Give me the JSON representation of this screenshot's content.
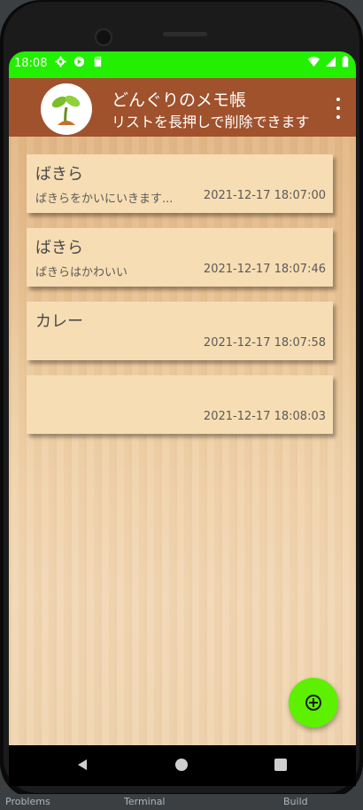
{
  "status_bar": {
    "time": "18:08",
    "background": "#22f000"
  },
  "app_bar": {
    "title": "どんぐりのメモ帳",
    "subtitle": "リストを長押しで削除できます",
    "background": "#a0522d"
  },
  "memos": [
    {
      "title": "ばきら",
      "body": "ばきらをかいにいきます...",
      "date": "2021-12-17 18:07:00"
    },
    {
      "title": "ばきら",
      "body": "ばきらはかわいい",
      "date": "2021-12-17 18:07:46"
    },
    {
      "title": "カレー",
      "body": "",
      "date": "2021-12-17 18:07:58"
    },
    {
      "title": "",
      "body": "",
      "date": "2021-12-17 18:08:03"
    }
  ],
  "fab": {
    "icon": "add-circle-icon",
    "color": "#5df000"
  },
  "ide_strip": [
    "Problems",
    "Terminal",
    "Build"
  ]
}
